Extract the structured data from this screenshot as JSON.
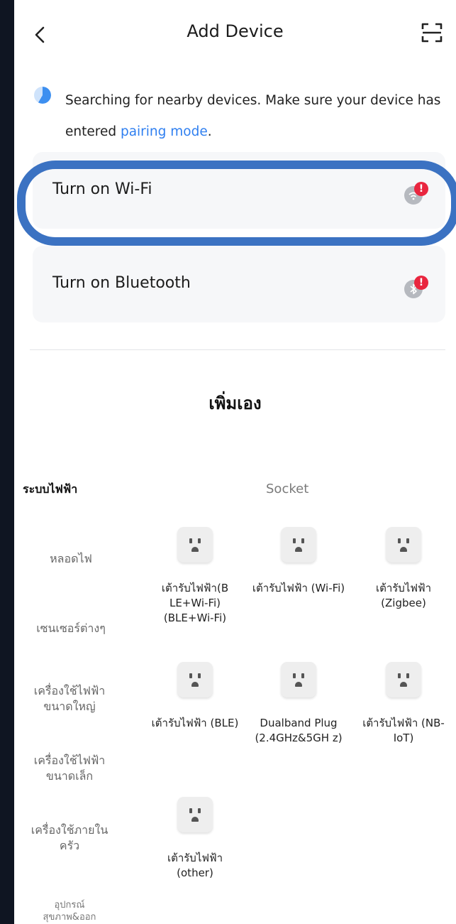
{
  "header": {
    "title": "Add Device"
  },
  "search": {
    "message": "Searching for nearby devices. Make sure your device has entered ",
    "link": "pairing mode",
    "suffix": "."
  },
  "cards": {
    "wifi_label": "Turn on Wi-Fi",
    "bluetooth_label": "Turn on Bluetooth",
    "alert_symbol": "!"
  },
  "manual": {
    "title": "เพิ่มเอง"
  },
  "sidebar": {
    "items": [
      "ระบบไฟฟ้า",
      "หลอดไฟ",
      "เซนเซอร์ต่างๆ",
      "เครื่องใช้ไฟฟ้า ขนาดใหญ่",
      "เครื่องใช้ไฟฟ้า ขนาดเล็ก",
      "เครื่องใช้ภายใน ครัว",
      "อุปกรณ์ สุขภาพ&ออกกำลัง..."
    ]
  },
  "category": {
    "header": "Socket",
    "devices": [
      {
        "name": "เต้ารับไฟฟ้า(B LE+Wi-Fi) (BLE+Wi-Fi)"
      },
      {
        "name": "เต้ารับไฟฟ้า (Wi-Fi)"
      },
      {
        "name": "เต้ารับไฟฟ้า (Zigbee)"
      },
      {
        "name": "เต้ารับไฟฟ้า (BLE)"
      },
      {
        "name": "Dualband Plug (2.4GHz&5GH z)"
      },
      {
        "name": "เต้ารับไฟฟ้า (NB-IoT)"
      },
      {
        "name": "เต้ารับไฟฟ้า (other)"
      }
    ]
  },
  "colors": {
    "accent": "#2f7ff0",
    "highlight": "#3b72c2",
    "alert": "#e9263f",
    "background": "#0f1522"
  }
}
